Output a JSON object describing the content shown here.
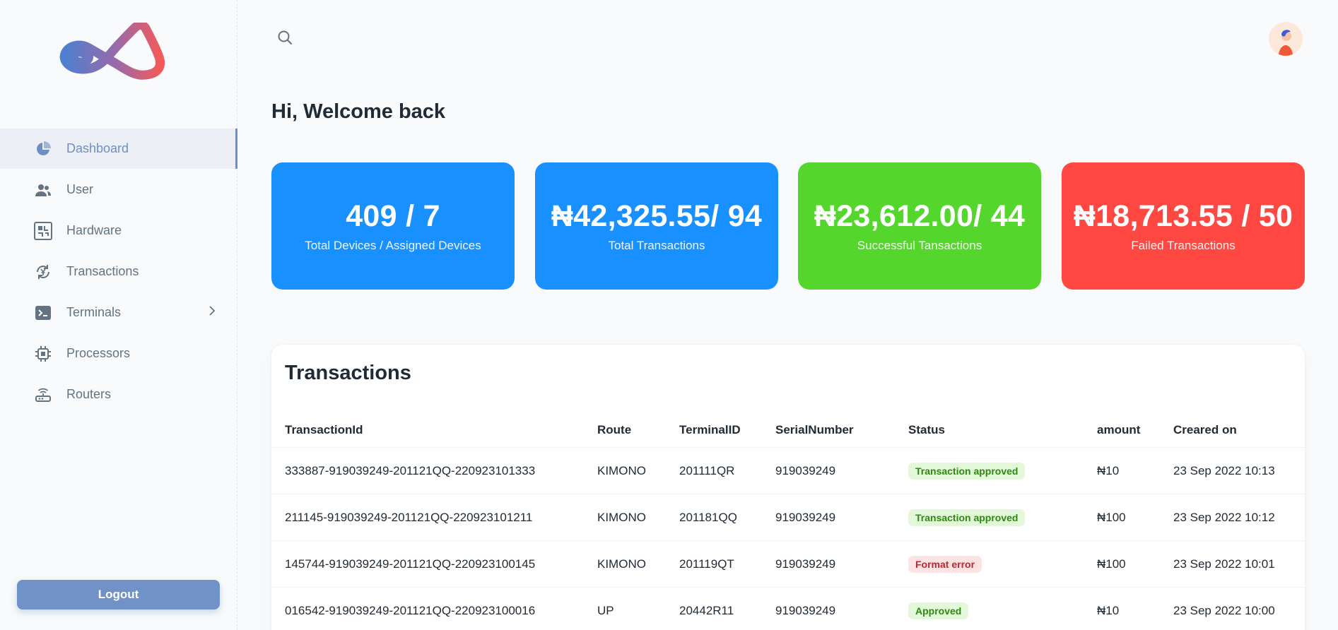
{
  "sidebar": {
    "items": [
      {
        "label": "Dashboard",
        "icon": "pie-chart-icon",
        "active": true
      },
      {
        "label": "User",
        "icon": "users-icon"
      },
      {
        "label": "Hardware",
        "icon": "circuit-board-icon"
      },
      {
        "label": "Transactions",
        "icon": "currency-cycle-icon"
      },
      {
        "label": "Terminals",
        "icon": "terminal-icon",
        "has_submenu": true
      },
      {
        "label": "Processors",
        "icon": "cpu-icon"
      },
      {
        "label": "Routers",
        "icon": "router-icon"
      }
    ],
    "logout_label": "Logout"
  },
  "header": {
    "greeting": "Hi, Welcome back"
  },
  "stats": [
    {
      "value": "409 / 7",
      "label": "Total Devices / Assigned Devices",
      "color": "#1890ff"
    },
    {
      "value": "₦42,325.55/ 94",
      "label": "Total Transactions",
      "color": "#1890ff"
    },
    {
      "value": "₦23,612.00/ 44",
      "label": "Successful Tansactions",
      "color": "#54d62c"
    },
    {
      "value": "₦18,713.55 / 50",
      "label": "Failed Transactions",
      "color": "#ff4842"
    }
  ],
  "transactions": {
    "title": "Transactions",
    "columns": [
      "TransactionId",
      "Route",
      "TerminalID",
      "SerialNumber",
      "Status",
      "amount",
      "Creared on"
    ],
    "rows": [
      {
        "id": "333887-919039249-201121QQ-220923101333",
        "route": "KIMONO",
        "terminal": "201111QR",
        "serial": "919039249",
        "status": "Transaction approved",
        "status_type": "ok",
        "amount": "₦10",
        "created": "23 Sep 2022 10:13"
      },
      {
        "id": "211145-919039249-201121QQ-220923101211",
        "route": "KIMONO",
        "terminal": "201181QQ",
        "serial": "919039249",
        "status": "Transaction approved",
        "status_type": "ok",
        "amount": "₦100",
        "created": "23 Sep 2022 10:12"
      },
      {
        "id": "145744-919039249-201121QQ-220923100145",
        "route": "KIMONO",
        "terminal": "201119QT",
        "serial": "919039249",
        "status": "Format error",
        "status_type": "err",
        "amount": "₦100",
        "created": "23 Sep 2022 10:01"
      },
      {
        "id": "016542-919039249-201121QQ-220923100016",
        "route": "UP",
        "terminal": "20442R11",
        "serial": "919039249",
        "status": "Approved",
        "status_type": "ok",
        "amount": "₦10",
        "created": "23 Sep 2022 10:00"
      }
    ]
  },
  "colors": {
    "accent": "#6f8fc3",
    "blue": "#1890ff",
    "green": "#54d62c",
    "red": "#ff4842"
  }
}
